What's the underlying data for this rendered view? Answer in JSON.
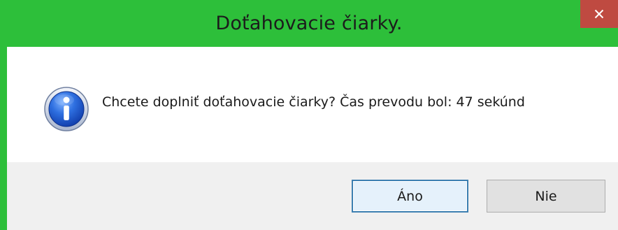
{
  "window": {
    "title": "Doťahovacie čiarky.",
    "accent_color": "#2dbf3a",
    "close_icon": "close-icon"
  },
  "message": {
    "icon": "info-icon",
    "text": "Chcete doplniť doťahovacie čiarky? Čas prevodu bol: 47 sekúnd"
  },
  "buttons": {
    "yes_label": "Áno",
    "no_label": "Nie"
  }
}
